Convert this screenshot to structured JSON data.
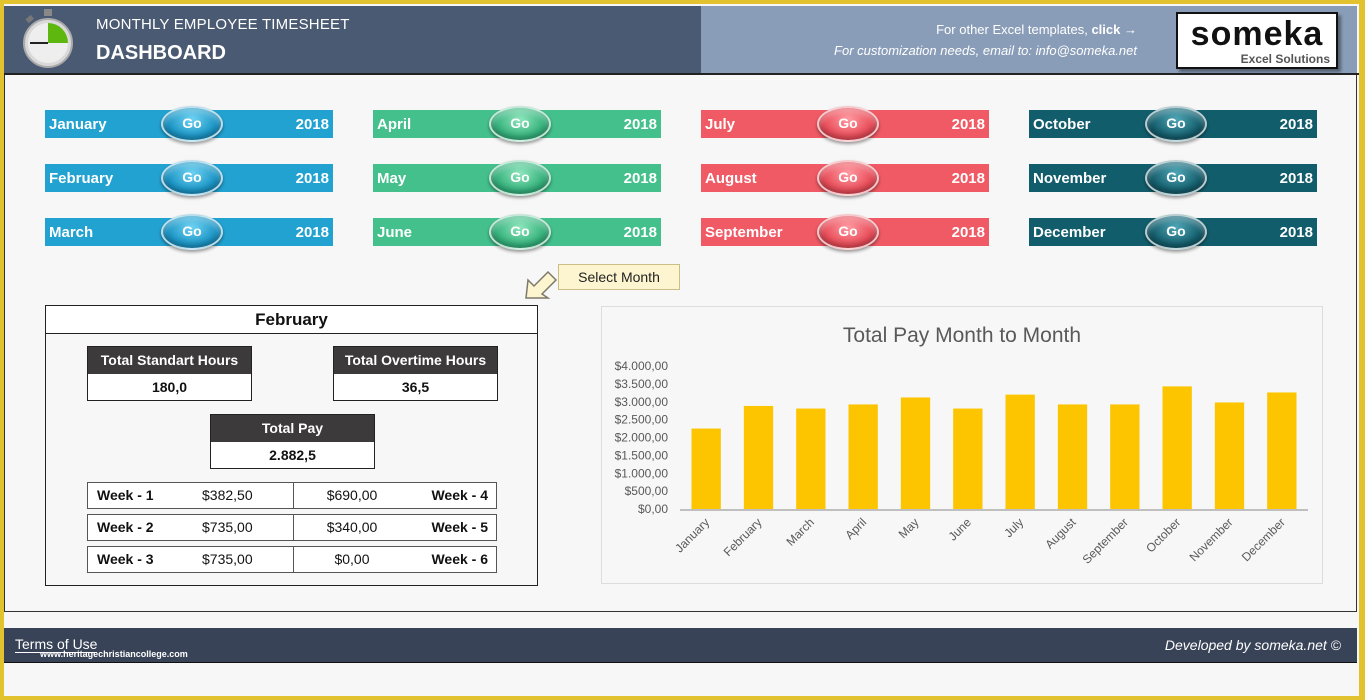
{
  "header": {
    "subtitle": "MONTHLY EMPLOYEE TIMESHEET",
    "title": "DASHBOARD",
    "promo_text": "For other Excel templates, ",
    "promo_link": "click",
    "promo_arrow": "→",
    "contact": "For customization needs, email to: info@someka.net",
    "logo_brand": "someka",
    "logo_tagline": "Excel Solutions"
  },
  "months": [
    {
      "name": "January",
      "year": "2018",
      "go": "Go",
      "color": "#22a2d0"
    },
    {
      "name": "February",
      "year": "2018",
      "go": "Go",
      "color": "#22a2d0"
    },
    {
      "name": "March",
      "year": "2018",
      "go": "Go",
      "color": "#22a2d0"
    },
    {
      "name": "April",
      "year": "2018",
      "go": "Go",
      "color": "#44c08c"
    },
    {
      "name": "May",
      "year": "2018",
      "go": "Go",
      "color": "#44c08c"
    },
    {
      "name": "June",
      "year": "2018",
      "go": "Go",
      "color": "#44c08c"
    },
    {
      "name": "July",
      "year": "2018",
      "go": "Go",
      "color": "#f05a64"
    },
    {
      "name": "August",
      "year": "2018",
      "go": "Go",
      "color": "#f05a64"
    },
    {
      "name": "September",
      "year": "2018",
      "go": "Go",
      "color": "#f05a64"
    },
    {
      "name": "October",
      "year": "2018",
      "go": "Go",
      "color": "#125d6c"
    },
    {
      "name": "November",
      "year": "2018",
      "go": "Go",
      "color": "#125d6c"
    },
    {
      "name": "December",
      "year": "2018",
      "go": "Go",
      "color": "#125d6c"
    }
  ],
  "hint": "Select Month",
  "summary": {
    "month": "February",
    "standard_hours_label": "Total Standart Hours",
    "standard_hours": "180,0",
    "overtime_hours_label": "Total Overtime Hours",
    "overtime_hours": "36,5",
    "total_pay_label": "Total Pay",
    "total_pay": "2.882,5",
    "weeks": [
      {
        "left_label": "Week - 1",
        "left_value": "$382,50",
        "right_value": "$690,00",
        "right_label": "Week - 4"
      },
      {
        "left_label": "Week - 2",
        "left_value": "$735,00",
        "right_value": "$340,00",
        "right_label": "Week - 5"
      },
      {
        "left_label": "Week - 3",
        "left_value": "$735,00",
        "right_value": "$0,00",
        "right_label": "Week - 6"
      }
    ]
  },
  "chart_data": {
    "type": "bar",
    "title": "Total Pay Month to Month",
    "xlabel": "",
    "ylabel": "",
    "categories": [
      "January",
      "February",
      "March",
      "April",
      "May",
      "June",
      "July",
      "August",
      "September",
      "October",
      "November",
      "December"
    ],
    "values": [
      2250,
      2882.5,
      2810,
      2925,
      3120,
      2810,
      3200,
      2925,
      2925,
      3430,
      2980,
      3260
    ],
    "ylim": [
      0,
      4000
    ],
    "yticks": [
      0,
      500,
      1000,
      1500,
      2000,
      2500,
      3000,
      3500,
      4000
    ],
    "ytick_labels": [
      "$0,00",
      "$500,00",
      "$1.000,00",
      "$1.500,00",
      "$2.000,00",
      "$2.500,00",
      "$3.000,00",
      "$3.500,00",
      "$4.000,00"
    ],
    "bar_color": "#fcc500",
    "grid": false,
    "legend": "none"
  },
  "footer": {
    "terms": "Terms of Use",
    "watermark": "www.heritagechristiancollege.com",
    "developed": "Developed by someka.net ©"
  }
}
